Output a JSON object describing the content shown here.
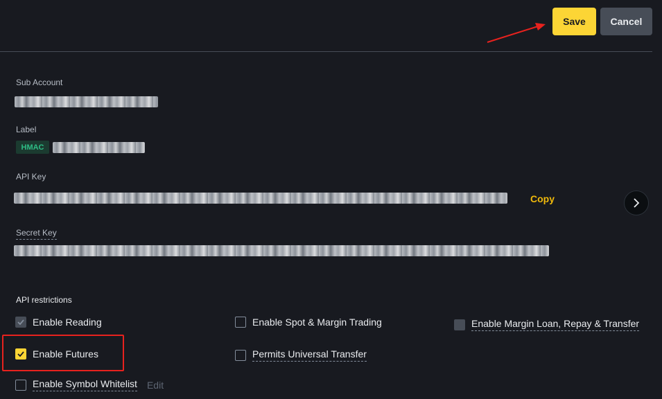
{
  "header": {
    "save_label": "Save",
    "cancel_label": "Cancel"
  },
  "form": {
    "sub_account_label": "Sub Account",
    "label_label": "Label",
    "hmac_badge": "HMAC",
    "api_key_label": "API Key",
    "copy_label": "Copy",
    "secret_key_label": "Secret Key"
  },
  "restrictions": {
    "title": "API restrictions",
    "items": [
      {
        "label": "Enable Reading",
        "state": "checked-disabled"
      },
      {
        "label": "Enable Spot & Margin Trading",
        "state": "unchecked"
      },
      {
        "label": "Enable Margin Loan, Repay & Transfer",
        "state": "disabled"
      },
      {
        "label": "Enable Futures",
        "state": "checked"
      },
      {
        "label": "Permits Universal Transfer",
        "state": "unchecked"
      },
      {
        "label": "Enable Symbol Whitelist",
        "state": "unchecked"
      }
    ],
    "edit_label": "Edit"
  },
  "colors": {
    "background": "#181a20",
    "accent": "#fcd535",
    "annotation": "#e8221e",
    "hmac_text": "#2ebd85"
  }
}
